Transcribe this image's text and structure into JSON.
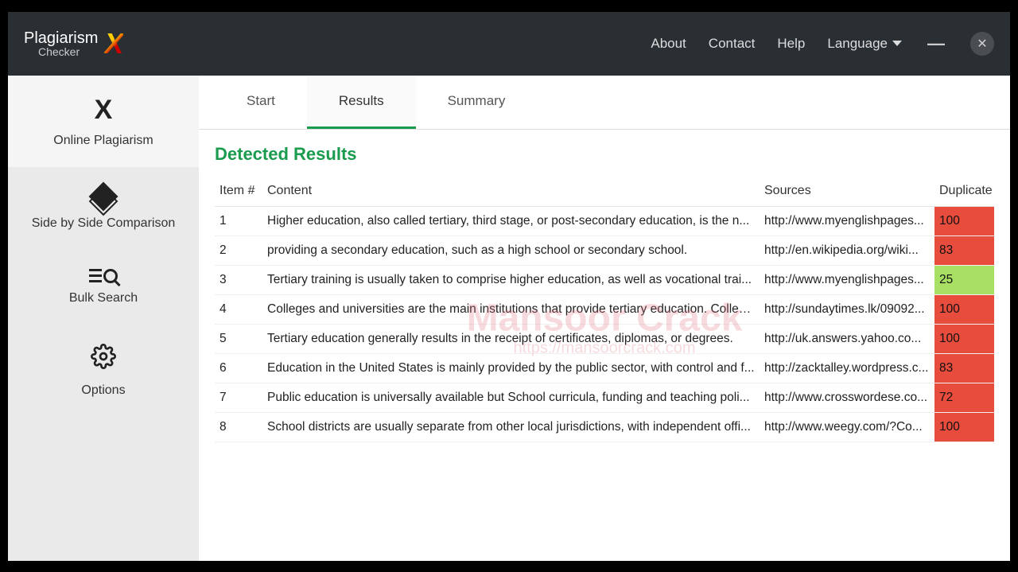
{
  "titlebar": {
    "logo_line1": "Plagiarism",
    "logo_line2": "Checker",
    "links": {
      "about": "About",
      "contact": "Contact",
      "help": "Help",
      "language": "Language"
    }
  },
  "sidebar": {
    "items": [
      {
        "label": "Online Plagiarism"
      },
      {
        "label": "Side by Side Comparison"
      },
      {
        "label": "Bulk Search"
      },
      {
        "label": "Options"
      }
    ]
  },
  "tabs": {
    "start": "Start",
    "results": "Results",
    "summary": "Summary"
  },
  "section_title": "Detected Results",
  "columns": {
    "item": "Item #",
    "content": "Content",
    "sources": "Sources",
    "duplicate": "Duplicate"
  },
  "rows": [
    {
      "item": "1",
      "content": "Higher education, also called tertiary, third stage, or post-secondary education, is the n...",
      "source": "http://www.myenglishpages...",
      "dup": "100",
      "cls": "dup-red"
    },
    {
      "item": "2",
      "content": "providing a secondary education, such as a high school or secondary school.",
      "source": "http://en.wikipedia.org/wiki...",
      "dup": "83",
      "cls": "dup-red"
    },
    {
      "item": "3",
      "content": "Tertiary training is usually taken to comprise higher education, as well as vocational trai...",
      "source": "http://www.myenglishpages...",
      "dup": "25",
      "cls": "dup-green"
    },
    {
      "item": "4",
      "content": "Colleges and universities are the main institutions that provide tertiary education. Collec...",
      "source": "http://sundaytimes.lk/09092...",
      "dup": "100",
      "cls": "dup-red"
    },
    {
      "item": "5",
      "content": "Tertiary education generally results in the receipt of certificates, diplomas, or degrees.",
      "source": "http://uk.answers.yahoo.co...",
      "dup": "100",
      "cls": "dup-red"
    },
    {
      "item": "6",
      "content": "Education in the United States is mainly provided by the public sector, with control and f...",
      "source": "http://zacktalley.wordpress.c...",
      "dup": "83",
      "cls": "dup-red"
    },
    {
      "item": "7",
      "content": "Public education is universally available but School curricula, funding and teaching poli...",
      "source": "http://www.crosswordese.co...",
      "dup": "72",
      "cls": "dup-red"
    },
    {
      "item": "8",
      "content": "School districts are usually separate from other local jurisdictions, with independent offi...",
      "source": "http://www.weegy.com/?Co...",
      "dup": "100",
      "cls": "dup-red"
    }
  ],
  "watermark": {
    "main": "Mansoor Crack",
    "sub": "https://mansoorcrack.com"
  }
}
